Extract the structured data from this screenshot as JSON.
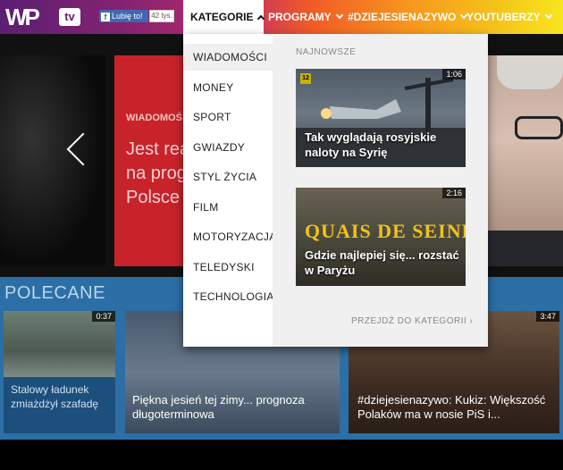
{
  "header": {
    "logo_text": "WP",
    "logo_tv": "tv",
    "fb_like_label": "Lubię to!",
    "fb_like_count": "42 tys.",
    "nav": [
      {
        "label": "KATEGORIE"
      },
      {
        "label": "PROGRAMY"
      },
      {
        "label": "#DZIEJESIENAZYWO"
      },
      {
        "label": "YOUTUBERZY"
      }
    ]
  },
  "hero": {
    "tag": "WIADOMOŚ",
    "headline_lines": [
      "Jest rea",
      "na prog",
      "Polsce"
    ]
  },
  "polecane": {
    "title": "POLECANE",
    "cards": [
      {
        "caption_lines": [
          "Stalowy ładunek",
          "zmiażdżył szafadę"
        ],
        "duration": "0:37"
      },
      {
        "caption_lines": [
          "Piękna jesień tej zimy... prognoza",
          "długoterminowa"
        ],
        "duration": ""
      },
      {
        "caption_lines": [
          "#dziejesienazywo: Kukiz: Większość",
          "Polaków ma w nosie PiS i..."
        ],
        "duration": "3:47"
      }
    ]
  },
  "dropdown": {
    "categories": [
      {
        "label": "WIADOMOŚCI"
      },
      {
        "label": "MONEY"
      },
      {
        "label": "SPORT"
      },
      {
        "label": "GWIAZDY"
      },
      {
        "label": "STYL ŻYCIA"
      },
      {
        "label": "FILM"
      },
      {
        "label": "MOTORYZACJA"
      },
      {
        "label": "TELEDYSKI"
      },
      {
        "label": "TECHNOLOGIA"
      }
    ],
    "latest_heading": "NAJNOWSZE",
    "videos": [
      {
        "caption_lines": [
          "Tak wyglądają rosyjskie",
          "naloty na Syrię"
        ],
        "duration": "1:06",
        "badge": "12"
      },
      {
        "caption_lines": [
          "Gdzie najlepiej się... rozstać",
          "w Paryżu"
        ],
        "duration": "2:16",
        "overlay": "QUAIS DE SEINE"
      }
    ],
    "goto_category": "PRZEJDŹ DO KATEGORII ›"
  },
  "colors": {
    "accent_red": "#c8232a",
    "polecane_blue": "#2c6fa6",
    "header_purple": "#5b1e73",
    "header_yellow": "#f8e51d"
  }
}
